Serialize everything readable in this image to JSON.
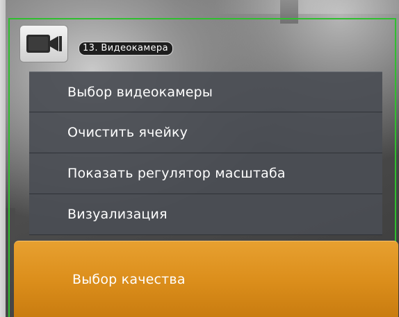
{
  "camera": {
    "icon": "video-camera-icon",
    "title": "13. Видеокамера"
  },
  "colors": {
    "active_border": "#2fbf2f",
    "menu_background": "#4a4e54",
    "highlight": "#dc8f1c",
    "text": "#ffffff"
  },
  "context_menu": {
    "items": [
      {
        "label": "Выбор видеокамеры"
      },
      {
        "label": "Очистить ячейку"
      },
      {
        "label": "Показать регулятор масштаба"
      },
      {
        "label": "Визуализация"
      }
    ],
    "active_item": {
      "label": "Выбор качества"
    }
  }
}
